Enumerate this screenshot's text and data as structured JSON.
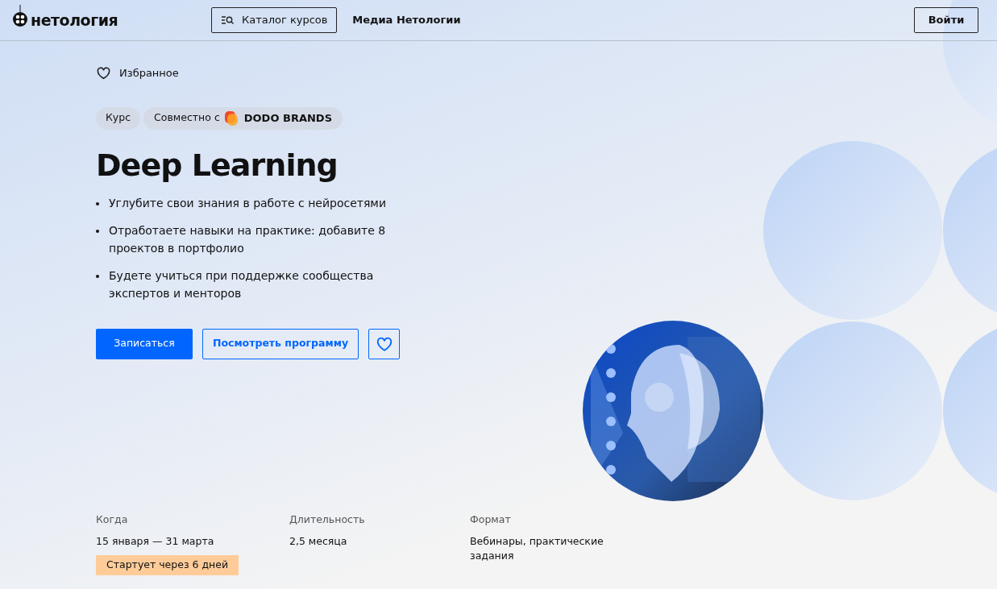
{
  "header": {
    "logo": "нетология",
    "catalog_button": "Каталог курсов",
    "media_link": "Медиа Нетологии",
    "login_button": "Войти"
  },
  "favorites_link": "Избранное",
  "tags": [
    {
      "kind": "plain",
      "label": "Курс"
    },
    {
      "kind": "partner",
      "label": "Совместно с",
      "partner": "DODO BRANDS"
    }
  ],
  "title": "Deep Learning",
  "bullets": [
    "Углубите свои знания в работе с нейросетями",
    "Отработаете навыки на практике: добавите 8 проектов в портфолио",
    "Будете учиться при поддержке сообщества экспертов и менторов"
  ],
  "actions": {
    "enroll": "Записаться",
    "program": "Посмотреть программу"
  },
  "info": [
    {
      "label": "Когда",
      "value": "15 января — 31 марта",
      "badge": "Стартует через 6 дней"
    },
    {
      "label": "Длительность",
      "value": "2,5 месяца"
    },
    {
      "label": "Формат",
      "value": "Вебинары, практические задания"
    }
  ]
}
